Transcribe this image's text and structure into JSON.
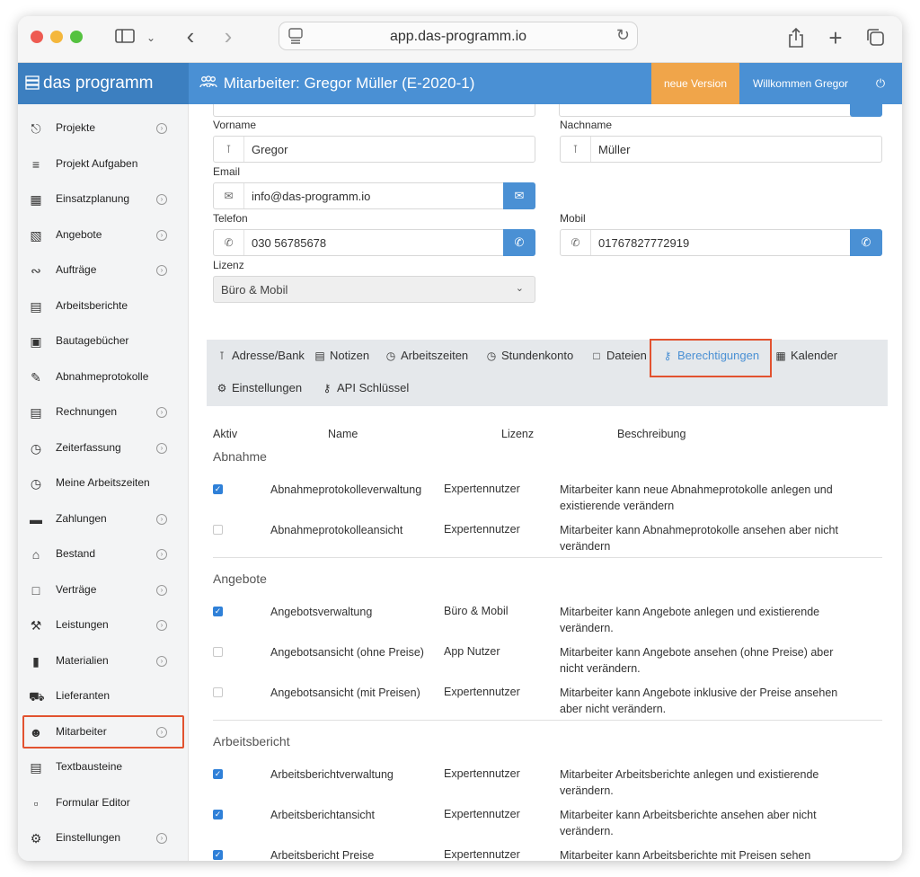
{
  "browser": {
    "url": "app.das-programm.io"
  },
  "header": {
    "brand": "das programm",
    "title": "Mitarbeiter: Gregor Müller (E-2020-1)",
    "version_button": "neue Version",
    "welcome": "Willkommen Gregor"
  },
  "sidebar": {
    "items": [
      {
        "label": "Projekte",
        "icon": "project-tree-icon",
        "chevron": true
      },
      {
        "label": "Projekt Aufgaben",
        "icon": "task-list-icon",
        "chevron": false
      },
      {
        "label": "Einsatzplanung",
        "icon": "calendar-icon",
        "chevron": true
      },
      {
        "label": "Angebote",
        "icon": "calculator-icon",
        "chevron": true
      },
      {
        "label": "Aufträge",
        "icon": "handshake-icon",
        "chevron": true
      },
      {
        "label": "Arbeitsberichte",
        "icon": "report-card-icon",
        "chevron": false
      },
      {
        "label": "Bautagebücher",
        "icon": "book-icon",
        "chevron": false
      },
      {
        "label": "Abnahmeprotokolle",
        "icon": "signature-icon",
        "chevron": false
      },
      {
        "label": "Rechnungen",
        "icon": "invoice-icon",
        "chevron": true
      },
      {
        "label": "Zeiterfassung",
        "icon": "clock-icon",
        "chevron": true
      },
      {
        "label": "Meine Arbeitszeiten",
        "icon": "clock-icon",
        "chevron": false
      },
      {
        "label": "Zahlungen",
        "icon": "cash-register-icon",
        "chevron": true
      },
      {
        "label": "Bestand",
        "icon": "warehouse-icon",
        "chevron": true
      },
      {
        "label": "Verträge",
        "icon": "contract-icon",
        "chevron": true
      },
      {
        "label": "Leistungen",
        "icon": "hammer-icon",
        "chevron": true
      },
      {
        "label": "Materialien",
        "icon": "barcode-icon",
        "chevron": true
      },
      {
        "label": "Lieferanten",
        "icon": "truck-icon",
        "chevron": false
      },
      {
        "label": "Mitarbeiter",
        "icon": "users-icon",
        "chevron": true
      },
      {
        "label": "Textbausteine",
        "icon": "document-icon",
        "chevron": false
      },
      {
        "label": "Formular Editor",
        "icon": "clipboard-icon",
        "chevron": false
      },
      {
        "label": "Einstellungen",
        "icon": "gears-icon",
        "chevron": true
      }
    ]
  },
  "form": {
    "vorname_label": "Vorname",
    "vorname": "Gregor",
    "nachname_label": "Nachname",
    "nachname": "Müller",
    "email_label": "Email",
    "email": "info@das-programm.io",
    "telefon_label": "Telefon",
    "telefon": "030 56785678",
    "mobil_label": "Mobil",
    "mobil": "01767827772919",
    "lizenz_label": "Lizenz",
    "lizenz": "Büro & Mobil"
  },
  "tabs": [
    {
      "label": "Adresse/Bank",
      "icon": "person-icon"
    },
    {
      "label": "Notizen",
      "icon": "note-icon"
    },
    {
      "label": "Arbeitszeiten",
      "icon": "clock-icon"
    },
    {
      "label": "Stundenkonto",
      "icon": "clock-icon"
    },
    {
      "label": "Dateien",
      "icon": "file-icon"
    },
    {
      "label": "Berechtigungen",
      "icon": "key-icon",
      "active": true
    },
    {
      "label": "Kalender",
      "icon": "calendar-icon"
    },
    {
      "label": "Einstellungen",
      "icon": "gears-icon"
    },
    {
      "label": "API Schlüssel",
      "icon": "key-icon"
    }
  ],
  "table": {
    "headers": {
      "aktiv": "Aktiv",
      "name": "Name",
      "lizenz": "Lizenz",
      "beschreibung": "Beschreibung"
    },
    "sections": [
      {
        "title": "Abnahme",
        "rows": [
          {
            "checked": true,
            "name": "Abnahmeprotokolleverwaltung",
            "lizenz": "Expertennutzer",
            "desc": "Mitarbeiter kann neue Abnahmeprotokolle anlegen und existierende verändern"
          },
          {
            "checked": false,
            "name": "Abnahmeprotokolleansicht",
            "lizenz": "Expertennutzer",
            "desc": "Mitarbeiter kann Abnahmeprotokolle ansehen aber nicht verändern"
          }
        ]
      },
      {
        "title": "Angebote",
        "rows": [
          {
            "checked": true,
            "name": "Angebotsverwaltung",
            "lizenz": "Büro & Mobil",
            "desc": "Mitarbeiter kann Angebote anlegen und existierende verändern."
          },
          {
            "checked": false,
            "name": "Angebotsansicht (ohne Preise)",
            "lizenz": "App Nutzer",
            "desc": "Mitarbeiter kann Angebote ansehen (ohne Preise) aber nicht verändern."
          },
          {
            "checked": false,
            "name": "Angebotsansicht (mit Preisen)",
            "lizenz": "Expertennutzer",
            "desc": "Mitarbeiter kann Angebote inklusive der Preise ansehen aber nicht verändern."
          }
        ]
      },
      {
        "title": "Arbeitsbericht",
        "rows": [
          {
            "checked": true,
            "name": "Arbeitsberichtverwaltung",
            "lizenz": "Expertennutzer",
            "desc": "Mitarbeiter Arbeitsberichte anlegen und existierende verändern."
          },
          {
            "checked": true,
            "name": "Arbeitsberichtansicht",
            "lizenz": "Expertennutzer",
            "desc": "Mitarbeiter kann Arbeitsberichte ansehen aber nicht verändern."
          },
          {
            "checked": true,
            "name": "Arbeitsbericht Preise",
            "lizenz": "Expertennutzer",
            "desc": "Mitarbeiter kann Arbeitsberichte mit Preisen sehen"
          }
        ]
      }
    ]
  },
  "colors": {
    "brand_blue": "#4a90d4",
    "brand_dark": "#3c7fc0",
    "version_orange": "#f0a54a",
    "highlight_red": "#e2522f",
    "checkbox_blue": "#2f80d8"
  }
}
